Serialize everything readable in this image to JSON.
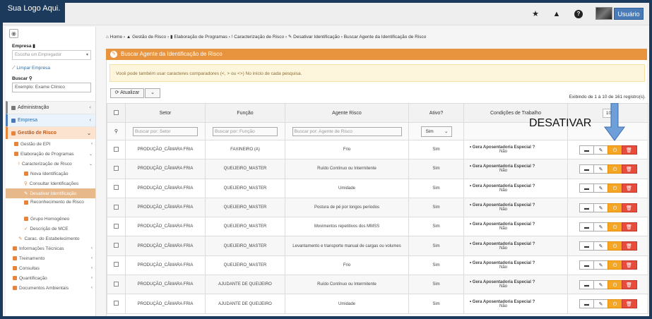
{
  "header": {
    "logo_text": "Sua Logo Aqui.",
    "user_label": "Usuário",
    "icons": [
      "star-icon",
      "warning-icon",
      "help-icon"
    ]
  },
  "sidebar": {
    "empresa_label": "Empresa",
    "empresa_placeholder": "Escolha um Empregador",
    "clear_link": "Limpar Empresa",
    "search_label": "Buscar",
    "search_placeholder": "Exemplo: Exame Clínico",
    "sections": [
      {
        "label": "Administração"
      },
      {
        "label": "Empresa"
      },
      {
        "label": "Gestão de Risco"
      }
    ],
    "items": [
      {
        "label": "Gestão de EPI",
        "indent": 1
      },
      {
        "label": "Elaboração de Programas",
        "indent": 1
      },
      {
        "label": "Caracterização de Risco",
        "indent": 2
      },
      {
        "label": "Nova Identificação",
        "indent": 3
      },
      {
        "label": "Consultar Identificações",
        "indent": 3
      },
      {
        "label": "Desativar Identificação",
        "indent": 3
      },
      {
        "label": "Reconhecimento de Risco",
        "indent": 3
      },
      {
        "label": "Grupo Homogêneo",
        "indent": 3
      },
      {
        "label": "Descrição de MCE",
        "indent": 3
      },
      {
        "label": "Carac. do Estabelecimento",
        "indent": 2
      }
    ],
    "bottom_items": [
      {
        "label": "Informações Técnicas"
      },
      {
        "label": "Treinamento"
      },
      {
        "label": "Consultas"
      },
      {
        "label": "Quantificação"
      },
      {
        "label": "Documentos Ambientais"
      }
    ]
  },
  "breadcrumb": {
    "home": "Home",
    "b1": "Gestão de Risco",
    "b2": "Elaboração de Programas",
    "b3": "Caracterização de Risco",
    "b4": "Desativar Identificação",
    "b5": "Buscar Agente da Identificação de Risco"
  },
  "panel": {
    "title": "Buscar Agente da Identificação de Risco",
    "alert": "Você pode também usar caracteres comparadores (<, > ou <>) No início de cada pesquisa.",
    "refresh_label": "Atualizar",
    "records_info": "Exibindo de 1 à 10 de 161 registro(s).",
    "page_size": "10"
  },
  "table": {
    "headers": [
      "Setor",
      "Função",
      "Agente Risco",
      "Ativo?",
      "Condições de Trabalho"
    ],
    "filters": {
      "setor": "Buscar por: Setor",
      "funcao": "Buscar por: Função",
      "agente": "Buscar por: Agente de Risco",
      "ativo": "Sim"
    },
    "condition_label": "Gera Aposentadoria Especial ?",
    "rows": [
      {
        "setor": "PRODUÇÃO_CÂMARA FRIA",
        "funcao": "FAXINEIRO (A)",
        "agente": "Frio",
        "ativo": "Sim",
        "cond": "Não"
      },
      {
        "setor": "PRODUÇÃO_CÂMARA FRIA",
        "funcao": "QUEIJEIRO_MASTER",
        "agente": "Ruído Contínuo ou Intermitente",
        "ativo": "Sim",
        "cond": "Não"
      },
      {
        "setor": "PRODUÇÃO_CÂMARA FRIA",
        "funcao": "QUEIJEIRO_MASTER",
        "agente": "Umidade",
        "ativo": "Sim",
        "cond": "Não"
      },
      {
        "setor": "PRODUÇÃO_CÂMARA FRIA",
        "funcao": "QUEIJEIRO_MASTER",
        "agente": "Postura de pé por longos períodos",
        "ativo": "Sim",
        "cond": "Não"
      },
      {
        "setor": "PRODUÇÃO_CÂMARA FRIA",
        "funcao": "QUEIJEIRO_MASTER",
        "agente": "Movimentos repetitivos dos MMSS",
        "ativo": "Sim",
        "cond": "Não"
      },
      {
        "setor": "PRODUÇÃO_CÂMARA FRIA",
        "funcao": "QUEIJEIRO_MASTER",
        "agente": "Levantamento e transporte manual de cargas ou volumes",
        "ativo": "Sim",
        "cond": "Não"
      },
      {
        "setor": "PRODUÇÃO_CÂMARA FRIA",
        "funcao": "QUEIJEIRO_MASTER",
        "agente": "Frio",
        "ativo": "Sim",
        "cond": "Não"
      },
      {
        "setor": "PRODUÇÃO_CÂMARA FRIA",
        "funcao": "AJUDANTE DE QUEIJEIRO",
        "agente": "Ruído Contínuo ou Intermitente",
        "ativo": "Sim",
        "cond": "Não"
      },
      {
        "setor": "PRODUÇÃO_CÂMARA FRIA",
        "funcao": "AJUDANTE DE QUEIJEIRO",
        "agente": "Umidade",
        "ativo": "Sim",
        "cond": "Não"
      }
    ]
  },
  "annotation": {
    "text": "DESATIVAR",
    "arrow_color": "#6f9fd8"
  }
}
